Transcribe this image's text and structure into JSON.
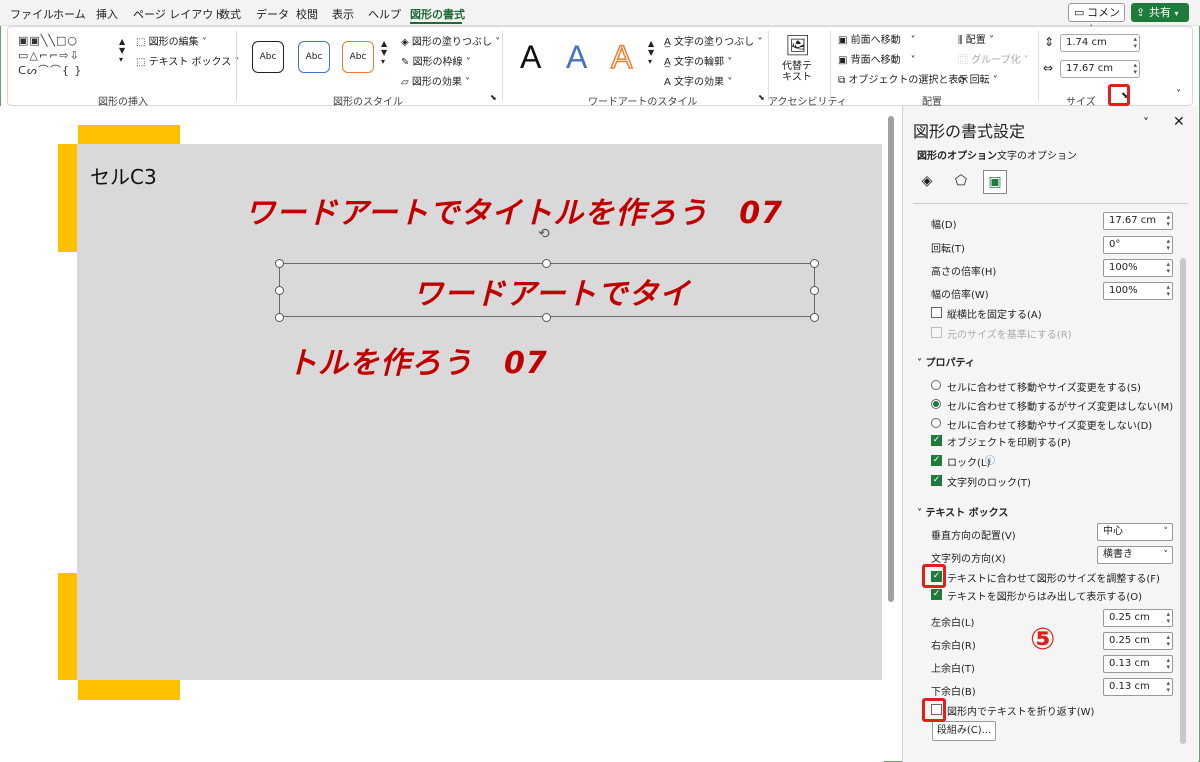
{
  "menu": {
    "items": [
      "ファイル",
      "ホーム",
      "挿入",
      "ページ レイアウト",
      "数式",
      "データ",
      "校閲",
      "表示",
      "ヘルプ",
      "図形の書式"
    ],
    "active": "図形の書式",
    "comment": "コメント",
    "share": "共有"
  },
  "ribbon": {
    "shape_insert": {
      "edit_shape": "図形の編集",
      "text_box": "テキスト ボックス",
      "label": "図形の挿入"
    },
    "shape_styles": {
      "abc": "Abc",
      "fill": "図形の塗りつぶし",
      "outline": "図形の枠線",
      "effects": "図形の効果",
      "label": "図形のスタイル"
    },
    "wordart_styles": {
      "a": "A",
      "text_fill": "文字の塗りつぶし",
      "text_outline": "文字の輪郭",
      "text_effects": "文字の効果",
      "label": "ワードアートのスタイル"
    },
    "accessibility": {
      "alt_text": "代替テキスト",
      "label": "アクセシビリティ"
    },
    "arrange": {
      "bring_forward": "前面へ移動",
      "send_backward": "背面へ移動",
      "selection_pane": "オブジェクトの選択と表示",
      "align": "配置",
      "group": "グループ化",
      "rotate": "回転",
      "label": "配置"
    },
    "size": {
      "height": "1.74 cm",
      "width": "17.67 cm",
      "label": "サイズ"
    }
  },
  "sheet": {
    "cell_label": "セルC3",
    "title_full": "ワードアートでタイトルを作ろう　07",
    "title_part1": "ワードアートでタイ",
    "title_part2": "トルを作ろう　07"
  },
  "pane": {
    "title": "図形の書式設定",
    "tab_shape": "図形のオプション",
    "tab_text": "文字のオプション",
    "size_rows": [
      {
        "label": "幅(D)",
        "value": "17.67 cm"
      },
      {
        "label": "回転(T)",
        "value": "0°"
      },
      {
        "label": "高さの倍率(H)",
        "value": "100%"
      },
      {
        "label": "幅の倍率(W)",
        "value": "100%"
      }
    ],
    "lock_aspect": "縦横比を固定する(A)",
    "relative_original": "元のサイズを基準にする(R)",
    "properties": "プロパティ",
    "prop_move_size": "セルに合わせて移動やサイズ変更をする(S)",
    "prop_move_only": "セルに合わせて移動するがサイズ変更はしない(M)",
    "prop_none": "セルに合わせて移動やサイズ変更をしない(D)",
    "print_object": "オブジェクトを印刷する(P)",
    "lock": "ロック(L)",
    "lock_text": "文字列のロック(T)",
    "textbox": "テキスト ボックス",
    "valign_label": "垂直方向の配置(V)",
    "valign_value": "中心",
    "dir_label": "文字列の方向(X)",
    "dir_value": "横書き",
    "resize_shape": "テキストに合わせて図形のサイズを調整する(F)",
    "overflow": "テキストを図形からはみ出して表示する(O)",
    "margins": [
      {
        "label": "左余白(L)",
        "value": "0.25 cm"
      },
      {
        "label": "右余白(R)",
        "value": "0.25 cm"
      },
      {
        "label": "上余白(T)",
        "value": "0.13 cm"
      },
      {
        "label": "下余白(B)",
        "value": "0.13 cm"
      }
    ],
    "wrap": "図形内でテキストを折り返す(W)",
    "columns": "段組み(C)...",
    "step_marker": "⑤"
  }
}
